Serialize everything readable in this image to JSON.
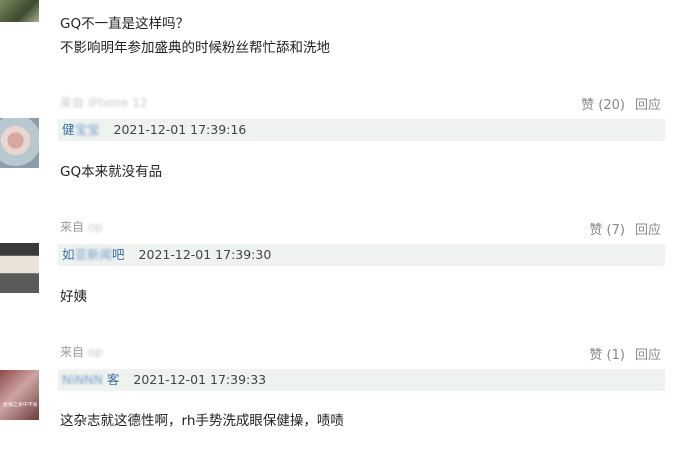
{
  "comments": [
    {
      "avatar_icon": "user-avatar-icon",
      "text_lines": [
        "GQ不一直是这样吗？",
        "不影响明年参加盛典的时候粉丝帮忙舔和洗地"
      ],
      "source": "来自 ",
      "source_blurred": "iPhone 12",
      "likes_label": "赞 (20)",
      "reply_label": "回应"
    },
    {
      "avatar_icon": "user-avatar-icon",
      "user_visible": "健",
      "user_blurred": "宝宝",
      "time": "2021-12-01 17:39:16",
      "text_lines": [
        "GQ本来就没有品"
      ],
      "source": "来自 ",
      "source_blurred": "op",
      "likes_label": "赞 (7)",
      "reply_label": "回应"
    },
    {
      "avatar_icon": "user-avatar-icon",
      "user_visible_prefix": "如",
      "user_blurred": "亚新闻",
      "user_visible_suffix": "吧",
      "time": "2021-12-01 17:39:30",
      "text_lines": [
        "好姨"
      ],
      "source": "来自 ",
      "source_blurred": "op",
      "likes_label": "赞 (1)",
      "reply_label": "回应"
    },
    {
      "avatar_icon": "user-avatar-icon",
      "user_blurred": "NiNNN ",
      "user_visible": "客",
      "time": "2021-12-01 17:39:33",
      "text_lines": [
        "这杂志就这德性啊，rh手势洗成眼保健操，啧啧"
      ],
      "avatar_text": "愿我之余中不受苦"
    }
  ]
}
